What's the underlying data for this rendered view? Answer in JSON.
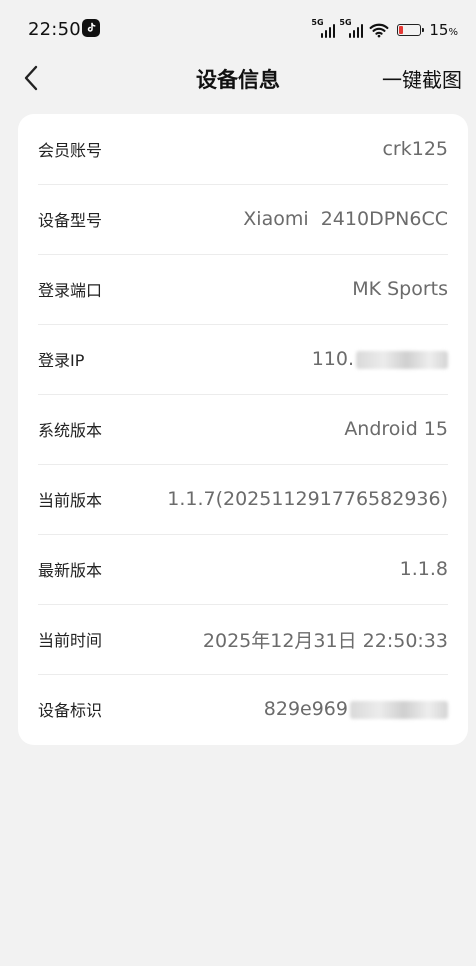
{
  "status_bar": {
    "time": "22:50",
    "battery_percent": "15",
    "battery_unit": "%",
    "battery_level": 0.15,
    "signal_tag_1": "5G",
    "signal_tag_2": "5G",
    "app_icon": "tiktok-icon",
    "wifi_icon": "wifi-icon",
    "battery_color": "#e53935"
  },
  "header": {
    "back_icon": "chevron-left-icon",
    "title": "设备信息",
    "action_label": "一键截图"
  },
  "device_info": {
    "rows": [
      {
        "label": "会员账号",
        "value": "crk125"
      },
      {
        "label": "设备型号",
        "value": "Xiaomi  2410DPN6CC"
      },
      {
        "label": "登录端口",
        "value": "MK Sports"
      },
      {
        "label": "登录IP",
        "value": "110."
      },
      {
        "label": "系统版本",
        "value": "Android 15"
      },
      {
        "label": "当前版本",
        "value": "1.1.7(202511291776582936)"
      },
      {
        "label": "最新版本",
        "value": "1.1.8"
      },
      {
        "label": "当前时间",
        "value": "2025年12月31日 22:50:33"
      },
      {
        "label": "设备标识",
        "value": "829e969"
      }
    ]
  }
}
